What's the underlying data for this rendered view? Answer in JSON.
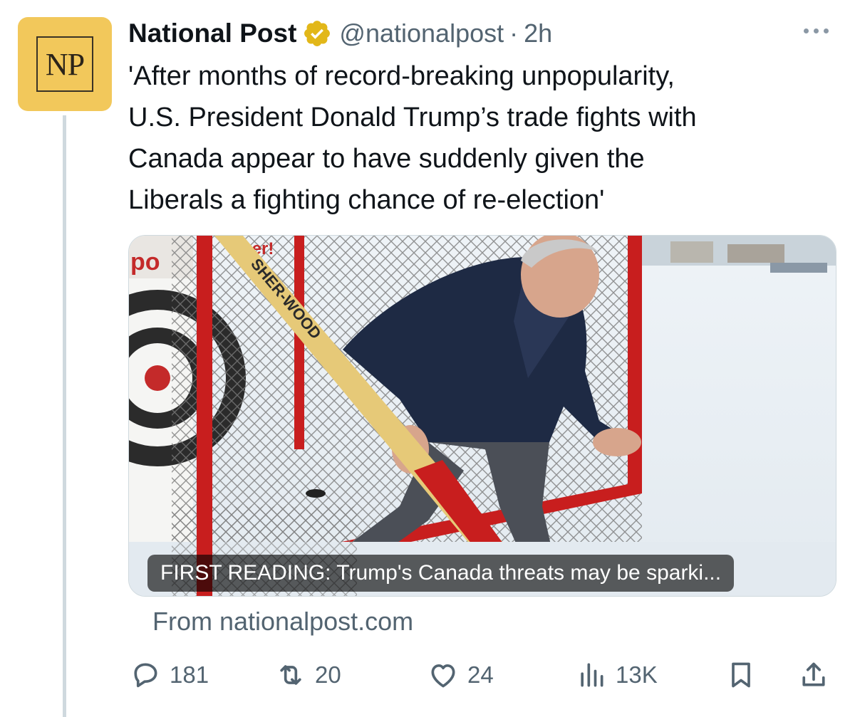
{
  "post": {
    "author_name": "National Post",
    "verified_badge": "gold-verified-icon",
    "handle": "@nationalpost",
    "separator": "·",
    "time": "2h",
    "avatar_text": "NP",
    "text": "'After months of record-breaking unpopularity,\nU.S. President Donald Trump’s trade fights with\nCanada appear to have suddenly given the\nLiberals a fighting chance of re-election'"
  },
  "card": {
    "caption": "FIRST READING: Trump's Canada threats may be sparki...",
    "source": "From nationalpost.com",
    "image": {
      "icon": "photo-hockey-net",
      "sign_text": "po",
      "banner_text": "ther!",
      "stick_text": "SHER-WOOD"
    }
  },
  "actions": {
    "replies": "181",
    "reposts": "20",
    "likes": "24",
    "views": "13K"
  },
  "colors": {
    "text_primary": "#0f1419",
    "text_secondary": "#536471",
    "avatar_bg": "#f2c85b",
    "badge_gold": "#e2b719",
    "thread_line": "#cfd9de"
  }
}
